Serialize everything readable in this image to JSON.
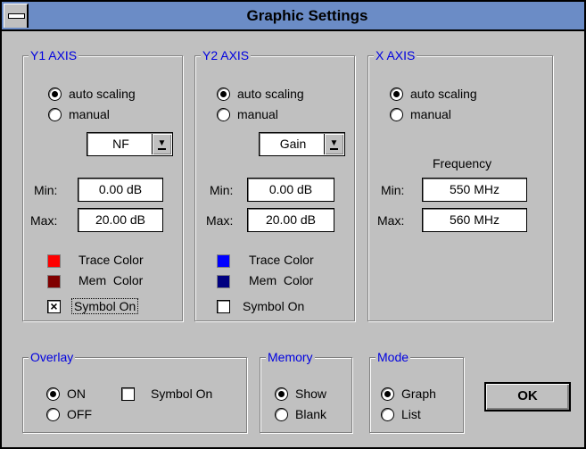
{
  "window": {
    "title": "Graphic Settings"
  },
  "colors": {
    "titlebar": "#6b8cc6",
    "group_label": "#0000e0",
    "y1_trace": "#ff0000",
    "y1_mem": "#800000",
    "y2_trace": "#0000ff",
    "y2_mem": "#000080"
  },
  "y1": {
    "label": "Y1 AXIS",
    "auto_label": "auto scaling",
    "manual_label": "manual",
    "auto_selected": true,
    "parameter": "NF",
    "min_label": "Min:",
    "min_value": "0.00 dB",
    "max_label": "Max:",
    "max_value": "20.00 dB",
    "trace_color_label": "Trace Color",
    "mem_color_label": "Mem  Color",
    "symbol_label": "Symbol On",
    "symbol_on": true
  },
  "y2": {
    "label": "Y2 AXIS",
    "auto_label": "auto scaling",
    "manual_label": "manual",
    "auto_selected": true,
    "parameter": "Gain",
    "min_label": "Min:",
    "min_value": "0.00 dB",
    "max_label": "Max:",
    "max_value": "20.00 dB",
    "trace_color_label": "Trace Color",
    "mem_color_label": "Mem  Color",
    "symbol_label": "Symbol On",
    "symbol_on": false
  },
  "x": {
    "label": "X AXIS",
    "auto_label": "auto scaling",
    "manual_label": "manual",
    "auto_selected": true,
    "heading": "Frequency",
    "min_label": "Min:",
    "min_value": "550 MHz",
    "max_label": "Max:",
    "max_value": "560 MHz"
  },
  "overlay": {
    "label": "Overlay",
    "on_label": "ON",
    "off_label": "OFF",
    "on_selected": true,
    "symbol_label": "Symbol On",
    "symbol_on": false
  },
  "memory": {
    "label": "Memory",
    "show_label": "Show",
    "blank_label": "Blank",
    "show_selected": true
  },
  "mode": {
    "label": "Mode",
    "graph_label": "Graph",
    "list_label": "List",
    "graph_selected": true
  },
  "ok_label": "OK"
}
